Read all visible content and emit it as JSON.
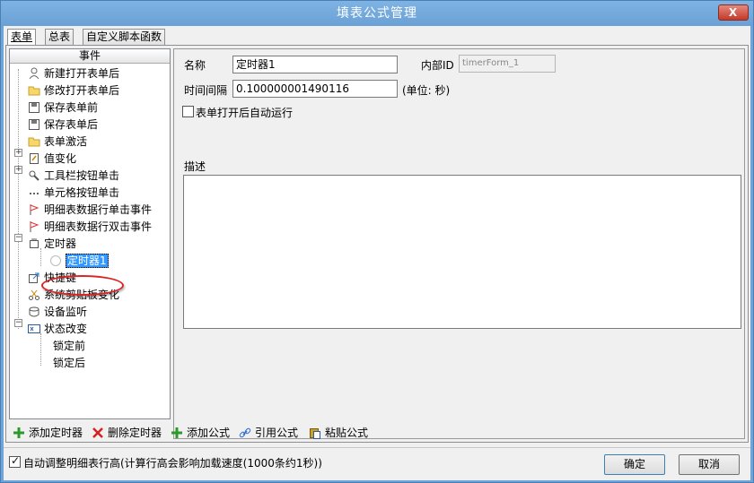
{
  "window": {
    "title": "填表公式管理",
    "close_label": "X"
  },
  "tabs": [
    {
      "label": "表单",
      "active": true
    },
    {
      "label": "总表",
      "active": false
    },
    {
      "label": "自定义脚本函数",
      "active": false
    }
  ],
  "tree": {
    "header": "事件",
    "items": [
      {
        "label": "新建打开表单后",
        "icon": "user-icon"
      },
      {
        "label": "修改打开表单后",
        "icon": "folder-icon"
      },
      {
        "label": "保存表单前",
        "icon": "save-icon"
      },
      {
        "label": "保存表单后",
        "icon": "save-icon"
      },
      {
        "label": "表单激活",
        "icon": "folder-icon"
      },
      {
        "label": "值变化",
        "icon": "edit-doc-icon"
      },
      {
        "label": "工具栏按钮单击",
        "icon": "tools-icon"
      },
      {
        "label": "单元格按钮单击",
        "icon": "dots-icon"
      },
      {
        "label": "明细表数据行单击事件",
        "icon": "flag-icon"
      },
      {
        "label": "明细表数据行双击事件",
        "icon": "flag-icon"
      },
      {
        "label": "定时器",
        "icon": "timer-icon"
      },
      {
        "label": "定时器1",
        "icon": "clock-icon"
      },
      {
        "label": "快捷键",
        "icon": "shortcut-icon"
      },
      {
        "label": "系统剪贴板变化",
        "icon": "scissors-icon"
      },
      {
        "label": "设备监听",
        "icon": "device-icon"
      },
      {
        "label": "状态改变",
        "icon": "state-icon"
      },
      {
        "label": "锁定前",
        "icon": ""
      },
      {
        "label": "锁定后",
        "icon": ""
      }
    ]
  },
  "form": {
    "name_label": "名称",
    "name_value": "定时器1",
    "internal_id_label": "内部ID",
    "internal_id_value": "timerForm_1",
    "interval_label": "时间间隔",
    "interval_value": "0.100000001490116",
    "interval_unit": "(单位: 秒)",
    "autorun_label": "表单打开后自动运行",
    "autorun_checked": false,
    "description_label": "描述",
    "description_value": ""
  },
  "toolbar": {
    "add_timer": "添加定时器",
    "delete_timer": "删除定时器",
    "add_formula": "添加公式",
    "reference_formula": "引用公式",
    "paste_formula": "粘贴公式"
  },
  "footer": {
    "auto_row_height_label": "自动调整明细表行高(计算行高会影响加载速度(1000条约1秒))",
    "auto_row_height_checked": true,
    "ok_label": "确定",
    "cancel_label": "取消"
  },
  "colors": {
    "titlebar": "#6ea4d8",
    "selection": "#3399ff",
    "highlight_oval": "#dd2222",
    "add_green": "#2a9a2a",
    "delete_red": "#d42020"
  }
}
